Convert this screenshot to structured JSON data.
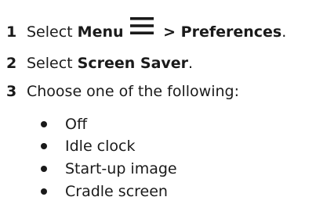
{
  "steps": [
    {
      "number": "1",
      "prefix": "Select ",
      "bold": "Menu",
      "icon": "menu-icon",
      "suffix_bold": " > Preferences",
      "suffix": "."
    },
    {
      "number": "2",
      "prefix": "Select ",
      "bold": "Screen Saver",
      "suffix": "."
    },
    {
      "number": "3",
      "text": "Choose one of the following:"
    }
  ],
  "options": [
    "Off",
    "Idle clock",
    "Start-up image",
    "Cradle screen"
  ],
  "colors": {
    "text": "#1a1a1a",
    "background": "#ffffff"
  }
}
